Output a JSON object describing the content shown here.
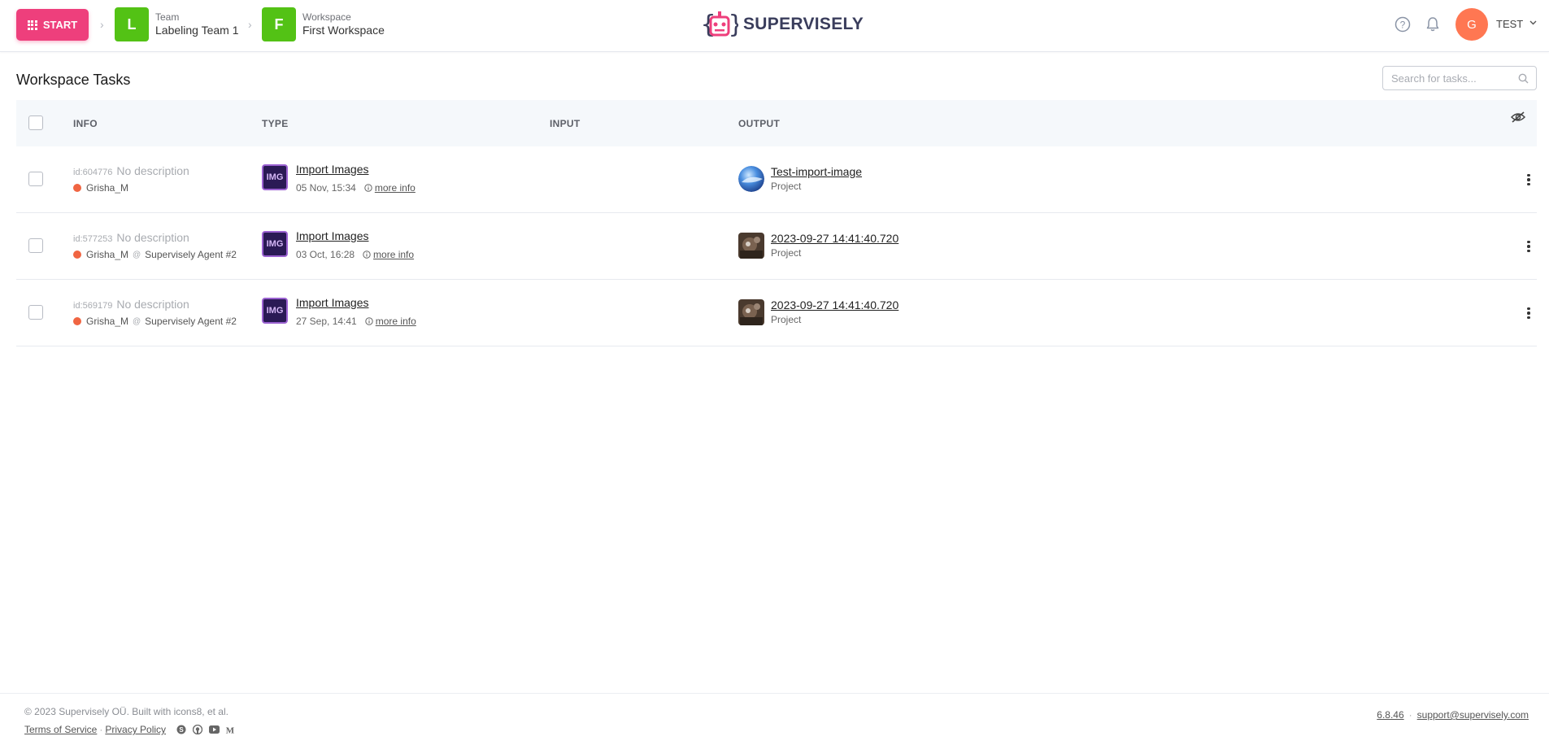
{
  "header": {
    "start_label": "START",
    "team": {
      "avatar": "L",
      "caption": "Team",
      "name": "Labeling Team 1"
    },
    "workspace": {
      "avatar": "F",
      "caption": "Workspace",
      "name": "First Workspace"
    },
    "logo_text": "SUPERVISELY",
    "user": {
      "avatar": "G",
      "name": "TEST"
    },
    "icons": [
      "help-icon",
      "bell-icon",
      "chevron-down-icon"
    ]
  },
  "page": {
    "title": "Workspace Tasks",
    "search_placeholder": "Search for tasks..."
  },
  "table": {
    "columns": [
      "INFO",
      "TYPE",
      "INPUT",
      "OUTPUT"
    ],
    "rows": [
      {
        "id": "id:604776",
        "description": "No description",
        "user": "Grisha_M",
        "agent": "",
        "type_icon": "IMG",
        "type_name": "Import Images",
        "date": "05 Nov, 15:34",
        "more_info": "more info",
        "output_name": "Test-import-image",
        "output_type": "Project"
      },
      {
        "id": "id:577253",
        "description": "No description",
        "user": "Grisha_M",
        "at": "@",
        "agent": "Supervisely Agent #2",
        "type_icon": "IMG",
        "type_name": "Import Images",
        "date": "03 Oct, 16:28",
        "more_info": "more info",
        "output_name": "2023-09-27 14:41:40.720",
        "output_type": "Project"
      },
      {
        "id": "id:569179",
        "description": "No description",
        "user": "Grisha_M",
        "at": "@",
        "agent": "Supervisely Agent #2",
        "type_icon": "IMG",
        "type_name": "Import Images",
        "date": "27 Sep, 14:41",
        "more_info": "more info",
        "output_name": "2023-09-27 14:41:40.720",
        "output_type": "Project"
      }
    ]
  },
  "footer": {
    "copyright": "© 2023 Supervisely OÜ. Built with icons8, et al.",
    "terms": "Terms of Service",
    "separator": "·",
    "privacy": "Privacy Policy",
    "social": [
      "skype-icon",
      "github-icon",
      "youtube-icon",
      "medium-icon"
    ],
    "version": "6.8.46",
    "support_email": "support@supervisely.com"
  },
  "colors": {
    "start_button": "#ee3f7c",
    "crumb_avatar": "#53c215",
    "user_avatar": "#ff7752",
    "user_dot": "#f06542",
    "table_header_bg": "#f5f8fb"
  }
}
